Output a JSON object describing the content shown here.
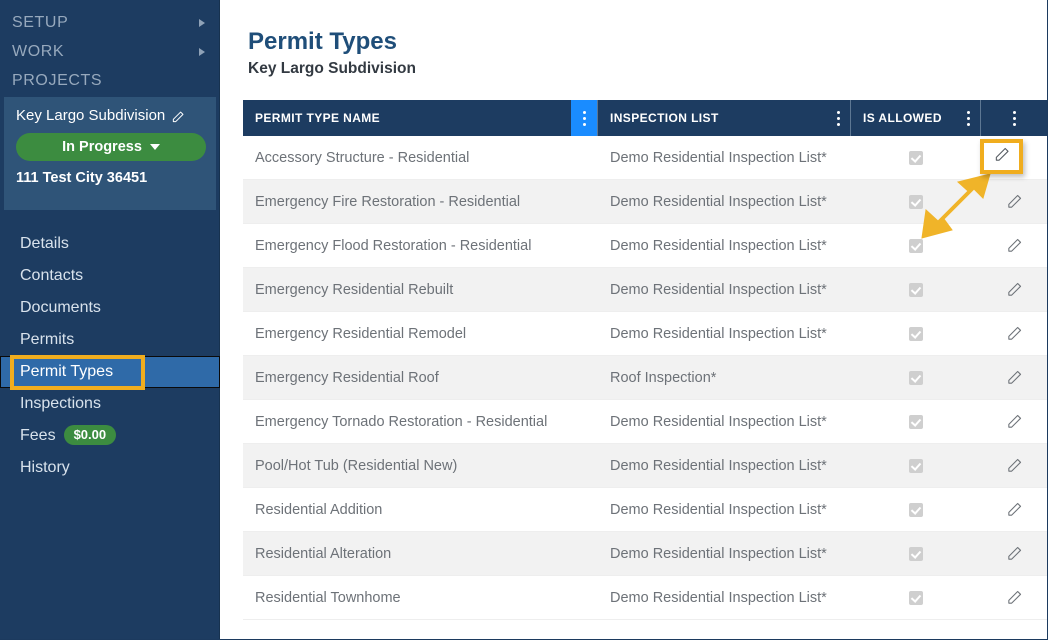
{
  "sidebar": {
    "top_nav": [
      {
        "label": "SETUP",
        "has_caret": true,
        "icon": "chevron-right-icon"
      },
      {
        "label": "WORK",
        "has_caret": true,
        "icon": "chevron-right-icon"
      },
      {
        "label": "PROJECTS",
        "has_caret": false,
        "icon": ""
      }
    ],
    "project_card": {
      "name": "Key Largo Subdivision",
      "edit_icon": "pencil-icon",
      "status": "In Progress",
      "status_color": "#3c8c40",
      "status_caret_icon": "chevron-down-icon",
      "address": "111 Test City 36451"
    },
    "section_nav": [
      {
        "label": "Details",
        "selected": false
      },
      {
        "label": "Contacts",
        "selected": false
      },
      {
        "label": "Documents",
        "selected": false
      },
      {
        "label": "Permits",
        "selected": false
      },
      {
        "label": "Permit Types",
        "selected": true
      },
      {
        "label": "Inspections",
        "selected": false
      },
      {
        "label": "Fees",
        "selected": false,
        "badge": "$0.00"
      },
      {
        "label": "History",
        "selected": false
      }
    ]
  },
  "main": {
    "title": "Permit Types",
    "subtitle": "Key Largo Subdivision",
    "table": {
      "columns": [
        {
          "label": "PERMIT TYPE NAME",
          "menu_icon": "kebab-menu-icon",
          "menu_active": true
        },
        {
          "label": "INSPECTION LIST",
          "menu_icon": "kebab-menu-icon",
          "menu_active": false
        },
        {
          "label": "IS ALLOWED",
          "menu_icon": "kebab-menu-icon",
          "menu_active": false
        },
        {
          "label": "",
          "menu_icon": "kebab-menu-icon",
          "menu_active": false
        }
      ],
      "rows": [
        {
          "name": "Accessory Structure - Residential",
          "inspection_list": "Demo Residential Inspection List*",
          "is_allowed": true,
          "edit_icon": "pencil-icon"
        },
        {
          "name": "Emergency Fire Restoration - Residential",
          "inspection_list": "Demo Residential Inspection List*",
          "is_allowed": true,
          "edit_icon": "pencil-icon"
        },
        {
          "name": "Emergency Flood Restoration - Residential",
          "inspection_list": "Demo Residential Inspection List*",
          "is_allowed": true,
          "edit_icon": "pencil-icon"
        },
        {
          "name": "Emergency Residential Rebuilt",
          "inspection_list": "Demo Residential Inspection List*",
          "is_allowed": true,
          "edit_icon": "pencil-icon"
        },
        {
          "name": "Emergency Residential Remodel",
          "inspection_list": "Demo Residential Inspection List*",
          "is_allowed": true,
          "edit_icon": "pencil-icon"
        },
        {
          "name": "Emergency Residential Roof",
          "inspection_list": "Roof Inspection*",
          "is_allowed": true,
          "edit_icon": "pencil-icon"
        },
        {
          "name": "Emergency Tornado Restoration - Residential",
          "inspection_list": "Demo Residential Inspection List*",
          "is_allowed": true,
          "edit_icon": "pencil-icon"
        },
        {
          "name": "Pool/Hot Tub (Residential New)",
          "inspection_list": "Demo Residential Inspection List*",
          "is_allowed": true,
          "edit_icon": "pencil-icon"
        },
        {
          "name": "Residential Addition",
          "inspection_list": "Demo Residential Inspection List*",
          "is_allowed": true,
          "edit_icon": "pencil-icon"
        },
        {
          "name": "Residential Alteration",
          "inspection_list": "Demo Residential Inspection List*",
          "is_allowed": true,
          "edit_icon": "pencil-icon"
        },
        {
          "name": "Residential Townhome",
          "inspection_list": "Demo Residential Inspection List*",
          "is_allowed": true,
          "edit_icon": "pencil-icon"
        }
      ]
    }
  },
  "annotations": {
    "color": "#f0ad1e",
    "highlight_nav_item": "Permit Types",
    "highlight_target": "edit-row-button",
    "arrow_icon": "arrow-up-right-icon"
  },
  "colors": {
    "sidebar_bg": "#1d3c61",
    "sidebar_card_bg": "#2f5478",
    "selected_nav_bg": "#2f6aa8",
    "accent_blue": "#1a8cff",
    "title_blue": "#1f4e79",
    "status_green": "#3c8c40",
    "annotation_gold": "#f0ad1e",
    "row_alt_bg": "#f2f2f2"
  }
}
